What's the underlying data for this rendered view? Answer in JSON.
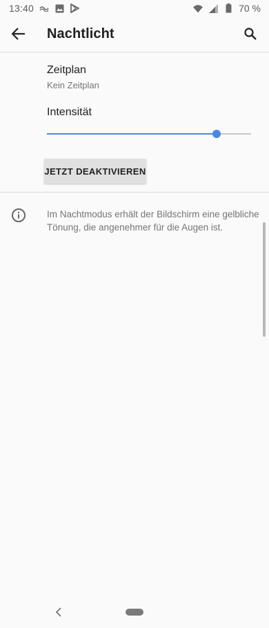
{
  "status_bar": {
    "time": "13:40",
    "battery_percent": "70 %",
    "left_icons": [
      "notification-icon",
      "image-icon",
      "play-store-icon"
    ],
    "right_icons": [
      "wifi-icon",
      "signal-icon",
      "battery-icon"
    ]
  },
  "header": {
    "title": "Nachtlicht",
    "back_icon": "arrow-back-icon",
    "search_icon": "search-icon"
  },
  "schedule": {
    "title": "Zeitplan",
    "summary": "Kein Zeitplan"
  },
  "intensity": {
    "label": "Intensität",
    "value_fraction": 0.83,
    "accent_color": "#4a86e8"
  },
  "deactivate_button": {
    "label": "JETZT DEAKTIVIEREN"
  },
  "info": {
    "icon": "info-icon",
    "text": "Im Nachtmodus erhält der Bildschirm eine gelbliche Tönung, die angenehmer für die Augen ist."
  },
  "nav_bar": {
    "back_icon": "nav-back-icon",
    "home_icon": "nav-home-pill"
  }
}
